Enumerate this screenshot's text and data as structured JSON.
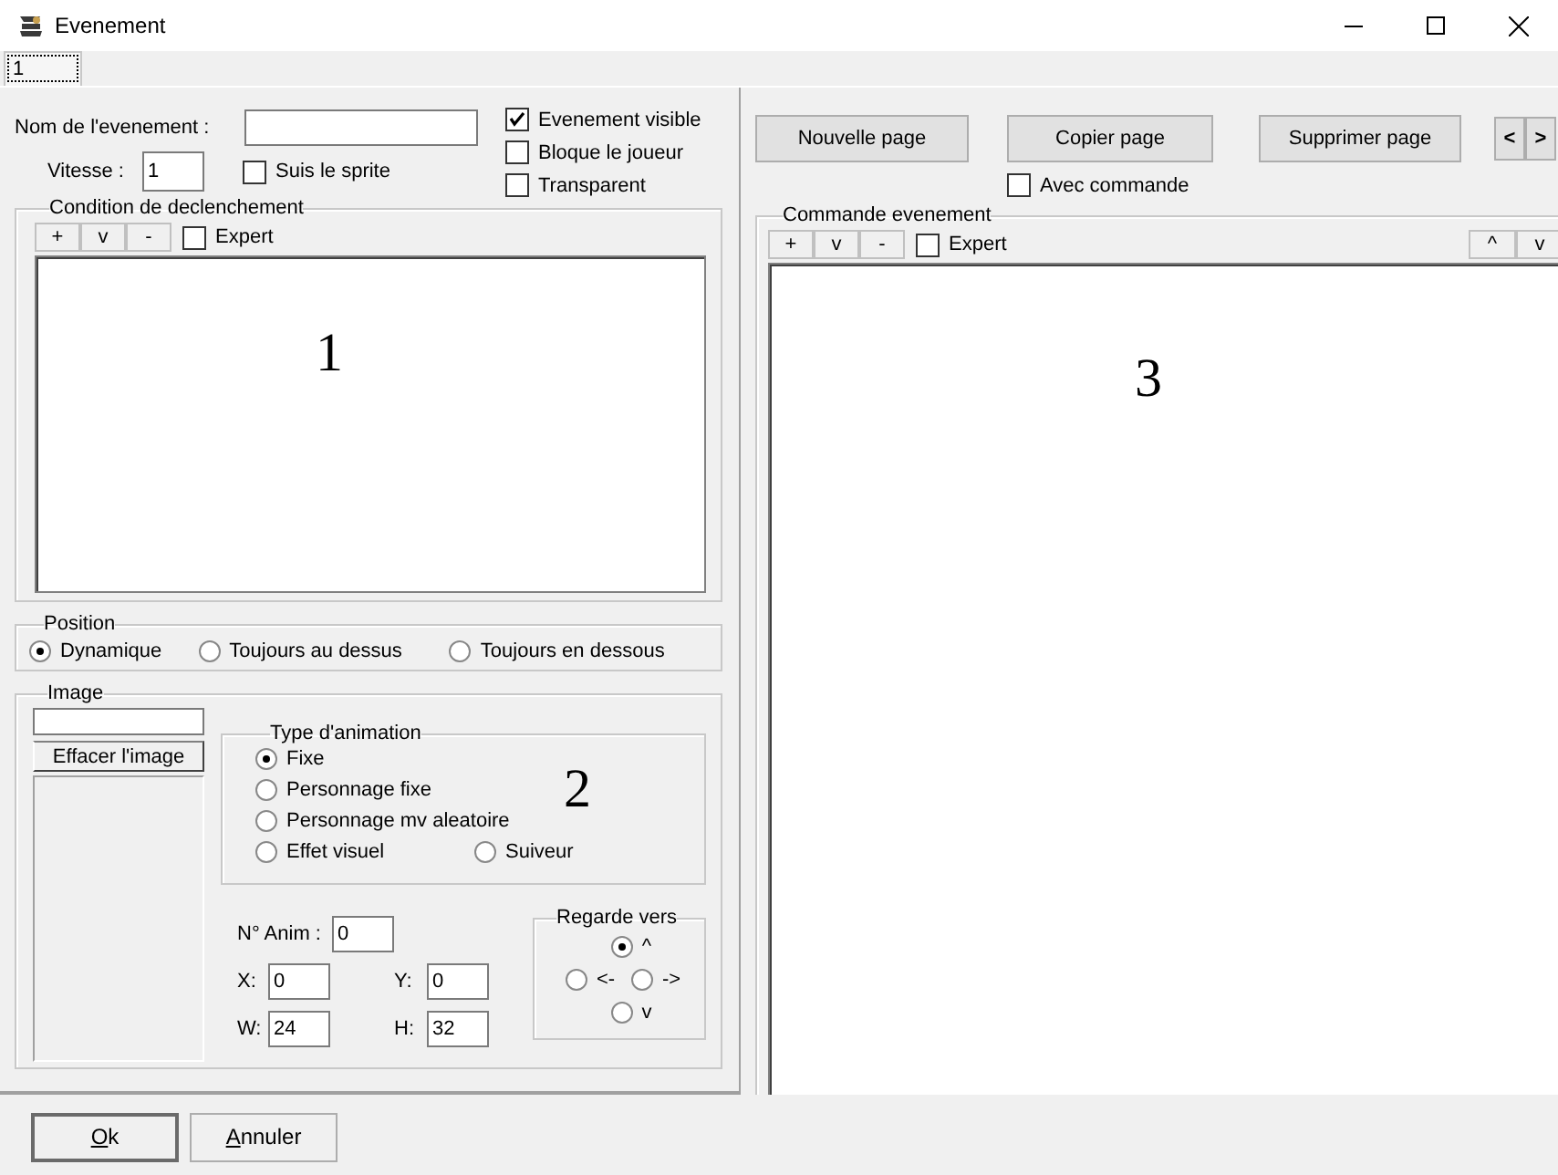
{
  "window": {
    "title": "Evenement"
  },
  "tabs": [
    {
      "label": "1",
      "selected": true
    }
  ],
  "event_name": {
    "label": "Nom de l'evenement :"
  },
  "speed": {
    "label": "Vitesse :",
    "value": "1"
  },
  "follow_sprite": {
    "label": "Suis le sprite",
    "checked": false
  },
  "flags": [
    {
      "label": "Evenement visible",
      "checked": true
    },
    {
      "label": "Bloque le joueur",
      "checked": false
    },
    {
      "label": "Transparent",
      "checked": false
    }
  ],
  "page_buttons": [
    "Nouvelle page",
    "Copier page",
    "Supprimer page"
  ],
  "nav_buttons": [
    "<",
    ">"
  ],
  "with_command": {
    "label": "Avec commande",
    "checked": false
  },
  "trigger_condition": {
    "title": "Condition de declenchement",
    "tools": [
      "+",
      "v",
      "-"
    ],
    "expert": {
      "label": "Expert",
      "checked": false
    },
    "annotation": "1"
  },
  "position": {
    "title": "Position",
    "options": [
      {
        "label": "Dynamique",
        "selected": true
      },
      {
        "label": "Toujours au dessus",
        "selected": false
      },
      {
        "label": "Toujours en dessous",
        "selected": false
      }
    ]
  },
  "image": {
    "title": "Image",
    "clear_button": "Effacer l'image"
  },
  "animation_type": {
    "title": "Type d'animation",
    "annotation": "2",
    "options": [
      {
        "label": "Fixe",
        "selected": true
      },
      {
        "label": "Personnage fixe",
        "selected": false
      },
      {
        "label": "Personnage mv aleatoire",
        "selected": false
      },
      {
        "label": "Effet visuel",
        "selected": false
      },
      {
        "label": "Suiveur",
        "selected": false
      }
    ]
  },
  "anim_number": {
    "label": "N° Anim :",
    "value": "0"
  },
  "anim_fields": [
    {
      "label": "X:",
      "value": "0"
    },
    {
      "label": "Y:",
      "value": "0"
    },
    {
      "label": "W:",
      "value": "24"
    },
    {
      "label": "H:",
      "value": "32"
    }
  ],
  "facing": {
    "title": "Regarde vers",
    "options": [
      {
        "label": "^",
        "selected": true
      },
      {
        "label": "<-",
        "selected": false
      },
      {
        "label": "->",
        "selected": false
      },
      {
        "label": "v",
        "selected": false
      }
    ]
  },
  "event_command": {
    "title": "Commande evenement",
    "tools": [
      "+",
      "v",
      "-"
    ],
    "expert": {
      "label": "Expert",
      "checked": false
    },
    "move_tools": [
      "^",
      "v"
    ],
    "annotation": "3"
  },
  "buttons": [
    "Ok",
    "Annuler"
  ]
}
